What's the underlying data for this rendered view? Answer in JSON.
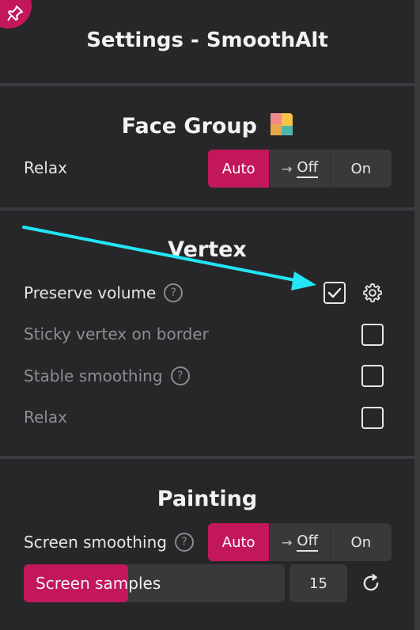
{
  "window": {
    "title": "Settings - SmoothAlt"
  },
  "face_group": {
    "title": "Face Group",
    "relax": {
      "label": "Relax",
      "options": [
        "Auto",
        "Off",
        "On"
      ],
      "selected": "Auto"
    }
  },
  "vertex": {
    "title": "Vertex",
    "preserve_volume": {
      "label": "Preserve volume",
      "checked": true
    },
    "sticky_vertex": {
      "label": "Sticky vertex on border",
      "checked": false
    },
    "stable_smoothing": {
      "label": "Stable smoothing",
      "checked": false
    },
    "relax": {
      "label": "Relax",
      "checked": false
    }
  },
  "painting": {
    "title": "Painting",
    "screen_smoothing": {
      "label": "Screen smoothing",
      "options": [
        "Auto",
        "Off",
        "On"
      ],
      "selected": "Auto"
    },
    "screen_samples": {
      "label": "Screen samples",
      "value": "15",
      "fill_fraction": 0.4
    }
  },
  "help_glyph": "?",
  "off_arrow": "→",
  "colors": {
    "accent": "#c2185b",
    "annotation_arrow": "#22e5f5",
    "background": "#272729"
  }
}
